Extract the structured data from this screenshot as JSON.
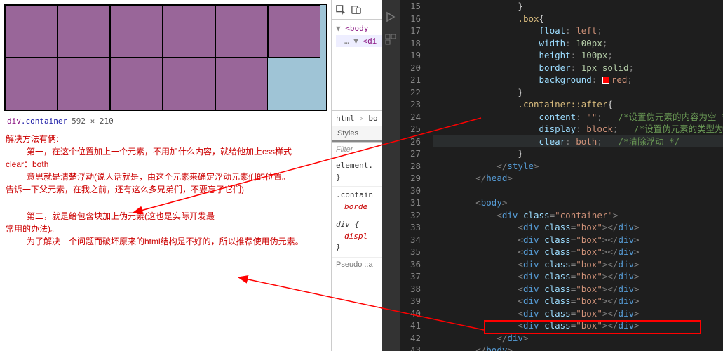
{
  "preview": {
    "inspect_tag": "div",
    "inspect_class": ".container",
    "inspect_dim": "592 × 210"
  },
  "annotations": {
    "l1": "解决方法有俩:",
    "l2": "第一，在这个位置加上一个元素，不用加什么内容，就给他加上css样式",
    "l3": "clear：both",
    "l4": "意思就是清楚浮动(说人话就是，由这个元素来确定浮动元素们的位置。",
    "l5": "告诉一下父元素，在我之前，还有这么多兄弟们，不要忘了它们)",
    "l6": "第二，就是给包含块加上伪元素(这也是实际开发最",
    "l7": "常用的办法)。",
    "l8": "为了解决一个问题而破坏原来的html结构是不好的，所以推荐使用伪元素。"
  },
  "devtools": {
    "dom_body": "<body",
    "dom_div": "<di",
    "bc_html": "html",
    "bc_body": "bo",
    "tab_styles": "Styles",
    "filter_placeholder": "Filter",
    "rule1_sel": "element.",
    "rule1_brace": "}",
    "rule2_sel": ".contain",
    "rule2_prop": "borde",
    "rule3_sel": "div {",
    "rule3_prop": "displ",
    "rule3_brace": "}",
    "pseudo": "Pseudo ::a"
  },
  "editor": {
    "lines": [
      {
        "n": 15,
        "ind": 4,
        "t": "brace",
        "txt": "}"
      },
      {
        "n": 16,
        "ind": 4,
        "t": "sel-open",
        "sel": ".box"
      },
      {
        "n": 17,
        "ind": 5,
        "t": "prop",
        "prop": "float",
        "val": "left"
      },
      {
        "n": 18,
        "ind": 5,
        "t": "prop",
        "prop": "width",
        "val": "100px",
        "num": true
      },
      {
        "n": 19,
        "ind": 5,
        "t": "prop",
        "prop": "height",
        "val": "100px",
        "num": true
      },
      {
        "n": 20,
        "ind": 5,
        "t": "prop",
        "prop": "border",
        "val": "1px solid",
        "num": true
      },
      {
        "n": 21,
        "ind": 5,
        "t": "prop-color",
        "prop": "background",
        "val": "red"
      },
      {
        "n": 22,
        "ind": 4,
        "t": "brace",
        "txt": "}"
      },
      {
        "n": 23,
        "ind": 4,
        "t": "sel-open",
        "sel": ".container::after"
      },
      {
        "n": 24,
        "ind": 5,
        "t": "prop-cmt",
        "prop": "content",
        "val": "\"\"",
        "cmt": "/*设置伪元素的内容为空 */"
      },
      {
        "n": 25,
        "ind": 5,
        "t": "prop-cmt",
        "prop": "display",
        "val": "block",
        "cmt": "/*设置伪元素的类型为块盒*/"
      },
      {
        "n": 26,
        "ind": 5,
        "t": "prop-cmt",
        "prop": "clear",
        "val": "both",
        "cmt": "/*清除浮动 */",
        "hl": true
      },
      {
        "n": 27,
        "ind": 4,
        "t": "brace",
        "txt": "}"
      },
      {
        "n": 28,
        "ind": 3,
        "t": "close-tag",
        "tag": "style"
      },
      {
        "n": 29,
        "ind": 2,
        "t": "close-tag",
        "tag": "head"
      },
      {
        "n": 30,
        "ind": 0,
        "t": "blank"
      },
      {
        "n": 31,
        "ind": 2,
        "t": "open-tag",
        "tag": "body"
      },
      {
        "n": 32,
        "ind": 3,
        "t": "open-tag-attr",
        "tag": "div",
        "attr": "class",
        "aval": "container"
      },
      {
        "n": 33,
        "ind": 4,
        "t": "div-box"
      },
      {
        "n": 34,
        "ind": 4,
        "t": "div-box"
      },
      {
        "n": 35,
        "ind": 4,
        "t": "div-box"
      },
      {
        "n": 36,
        "ind": 4,
        "t": "div-box"
      },
      {
        "n": 37,
        "ind": 4,
        "t": "div-box"
      },
      {
        "n": 38,
        "ind": 4,
        "t": "div-box"
      },
      {
        "n": 39,
        "ind": 4,
        "t": "div-box"
      },
      {
        "n": 40,
        "ind": 4,
        "t": "div-box"
      },
      {
        "n": 41,
        "ind": 4,
        "t": "div-box"
      },
      {
        "n": 42,
        "ind": 3,
        "t": "close-tag",
        "tag": "div"
      },
      {
        "n": 43,
        "ind": 2,
        "t": "close-tag",
        "tag": "body"
      }
    ],
    "divbox_attr": "class",
    "divbox_val": "box",
    "divbox_tag": "div"
  }
}
